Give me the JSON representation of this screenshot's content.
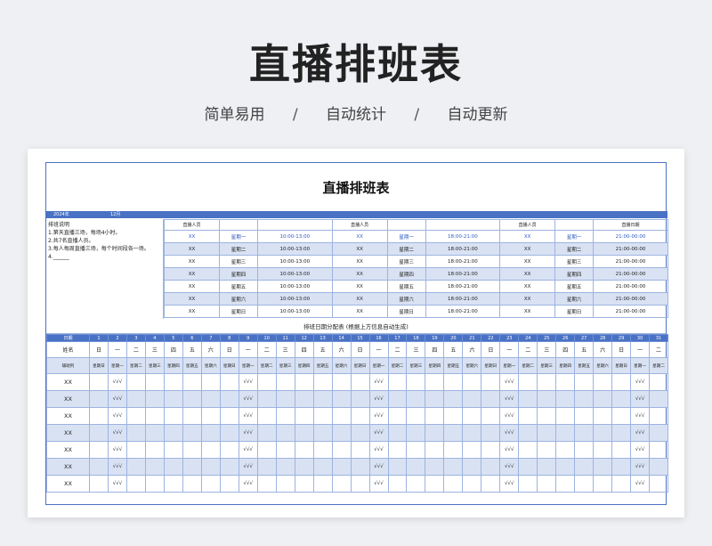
{
  "hero": {
    "title": "直播排班表",
    "sub1": "简单易用",
    "sep": "/",
    "sub2": "自动统计",
    "sub3": "自动更新"
  },
  "sheet": {
    "title": "直播排班表",
    "year": "2024年",
    "month": "12月",
    "notes": [
      "排班说明",
      "1.第天直播三场，每场4小时。",
      "2.共7名直播人员。",
      "3.每人每周直播三场，每个时间段各一场。",
      "4.______"
    ],
    "groups": [
      {
        "person_header": "直播人员",
        "time_header": "",
        "rows": [
          {
            "person": "XX",
            "day": "星期一",
            "time": "10:00-13:00",
            "highlight": true
          },
          {
            "person": "XX",
            "day": "星期二",
            "time": "10:00-13:00"
          },
          {
            "person": "XX",
            "day": "星期三",
            "time": "10:00-13:00"
          },
          {
            "person": "XX",
            "day": "星期四",
            "time": "10:00-13:00"
          },
          {
            "person": "XX",
            "day": "星期五",
            "time": "10:00-13:00"
          },
          {
            "person": "XX",
            "day": "星期六",
            "time": "10:00-13:00"
          },
          {
            "person": "XX",
            "day": "星期日",
            "time": "10:00-13:00"
          }
        ]
      },
      {
        "person_header": "直播人员",
        "time_header": "",
        "rows": [
          {
            "person": "XX",
            "day": "星期一",
            "time": "18:00-21:00",
            "highlight": true
          },
          {
            "person": "XX",
            "day": "星期二",
            "time": "18:00-21:00"
          },
          {
            "person": "XX",
            "day": "星期三",
            "time": "18:00-21:00"
          },
          {
            "person": "XX",
            "day": "星期四",
            "time": "18:00-21:00"
          },
          {
            "person": "XX",
            "day": "星期五",
            "time": "18:00-21:00"
          },
          {
            "person": "XX",
            "day": "星期六",
            "time": "18:00-21:00"
          },
          {
            "person": "XX",
            "day": "星期日",
            "time": "18:00-21:00"
          }
        ]
      },
      {
        "person_header": "直播人员",
        "time_header": "直播日期",
        "rows": [
          {
            "person": "XX",
            "day": "星期一",
            "time": "21:00-00:00",
            "highlight": true
          },
          {
            "person": "XX",
            "day": "星期二",
            "time": "21:00-00:00"
          },
          {
            "person": "XX",
            "day": "星期三",
            "time": "21:00-00:00"
          },
          {
            "person": "XX",
            "day": "星期四",
            "time": "21:00-00:00"
          },
          {
            "person": "XX",
            "day": "星期五",
            "time": "21:00-00:00"
          },
          {
            "person": "XX",
            "day": "星期六",
            "time": "21:00-00:00"
          },
          {
            "person": "XX",
            "day": "星期日",
            "time": "21:00-00:00"
          }
        ]
      }
    ],
    "calendar": {
      "title": "排班日期分配表 (根据上方信息自动生成)",
      "date_label": "日期",
      "name_label": "姓名",
      "helper_label": "辅助列",
      "days": [
        "1",
        "2",
        "3",
        "4",
        "5",
        "6",
        "7",
        "8",
        "9",
        "10",
        "11",
        "12",
        "13",
        "14",
        "15",
        "16",
        "17",
        "18",
        "19",
        "20",
        "21",
        "22",
        "23",
        "24",
        "25",
        "26",
        "27",
        "28",
        "29",
        "30",
        "31"
      ],
      "weekdays_short": [
        "日",
        "一",
        "二",
        "三",
        "四",
        "五",
        "六",
        "日",
        "一",
        "二",
        "三",
        "四",
        "五",
        "六",
        "日",
        "一",
        "二",
        "三",
        "四",
        "五",
        "六",
        "日",
        "一",
        "二",
        "三",
        "四",
        "五",
        "六",
        "日",
        "一",
        "二"
      ],
      "weekdays_long": [
        "星期日",
        "星期一",
        "星期二",
        "星期三",
        "星期四",
        "星期五",
        "星期六",
        "星期日",
        "星期一",
        "星期二",
        "星期三",
        "星期四",
        "星期五",
        "星期六",
        "星期日",
        "星期一",
        "星期二",
        "星期三",
        "星期四",
        "星期五",
        "星期六",
        "星期日",
        "星期一",
        "星期二",
        "星期三",
        "星期四",
        "星期五",
        "星期六",
        "星期日",
        "星期一",
        "星期二"
      ],
      "check_mark": "√√√",
      "people": [
        "XX",
        "XX",
        "XX",
        "XX",
        "XX",
        "XX",
        "XX"
      ],
      "check_columns": [
        2,
        9,
        16,
        23,
        30
      ]
    }
  },
  "colors": {
    "accent": "#4a72c4",
    "stripe": "#d9e2f3"
  }
}
